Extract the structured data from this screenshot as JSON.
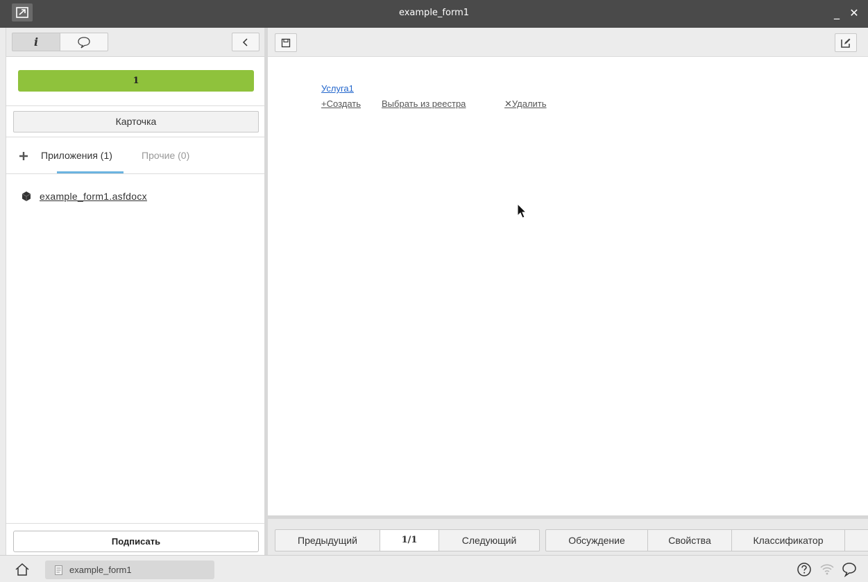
{
  "window": {
    "title": "example_form1",
    "minimize_label": "_",
    "close_label": "✕"
  },
  "sidebar": {
    "progress": {
      "label": "1",
      "fraction": 1.0,
      "color": "#8fc23c"
    },
    "card_button": "Карточка",
    "tabs": [
      {
        "label": "Приложения (1)",
        "active": true
      },
      {
        "label": "Прочие (0)",
        "active": false
      }
    ],
    "files": [
      {
        "name": "example_form1.asfdocx"
      }
    ],
    "sign_button": "Подписать"
  },
  "form": {
    "service_link": "Услуга1",
    "actions": {
      "create": "+Создать",
      "select": "Выбрать из реестра",
      "delete": "✕Удалить"
    }
  },
  "bottom_nav": {
    "prev": "Предыдущий",
    "page": "1/1",
    "next": "Следующий",
    "discussion": "Обсуждение",
    "properties": "Свойства",
    "classifier": "Классификатор"
  },
  "taskbar": {
    "item_label": "example_form1"
  },
  "colors": {
    "accent_blue": "#6bb3e0",
    "link_blue": "#2266cc",
    "progress_green": "#8fc23c",
    "titlebar": "#4a4a4a"
  }
}
